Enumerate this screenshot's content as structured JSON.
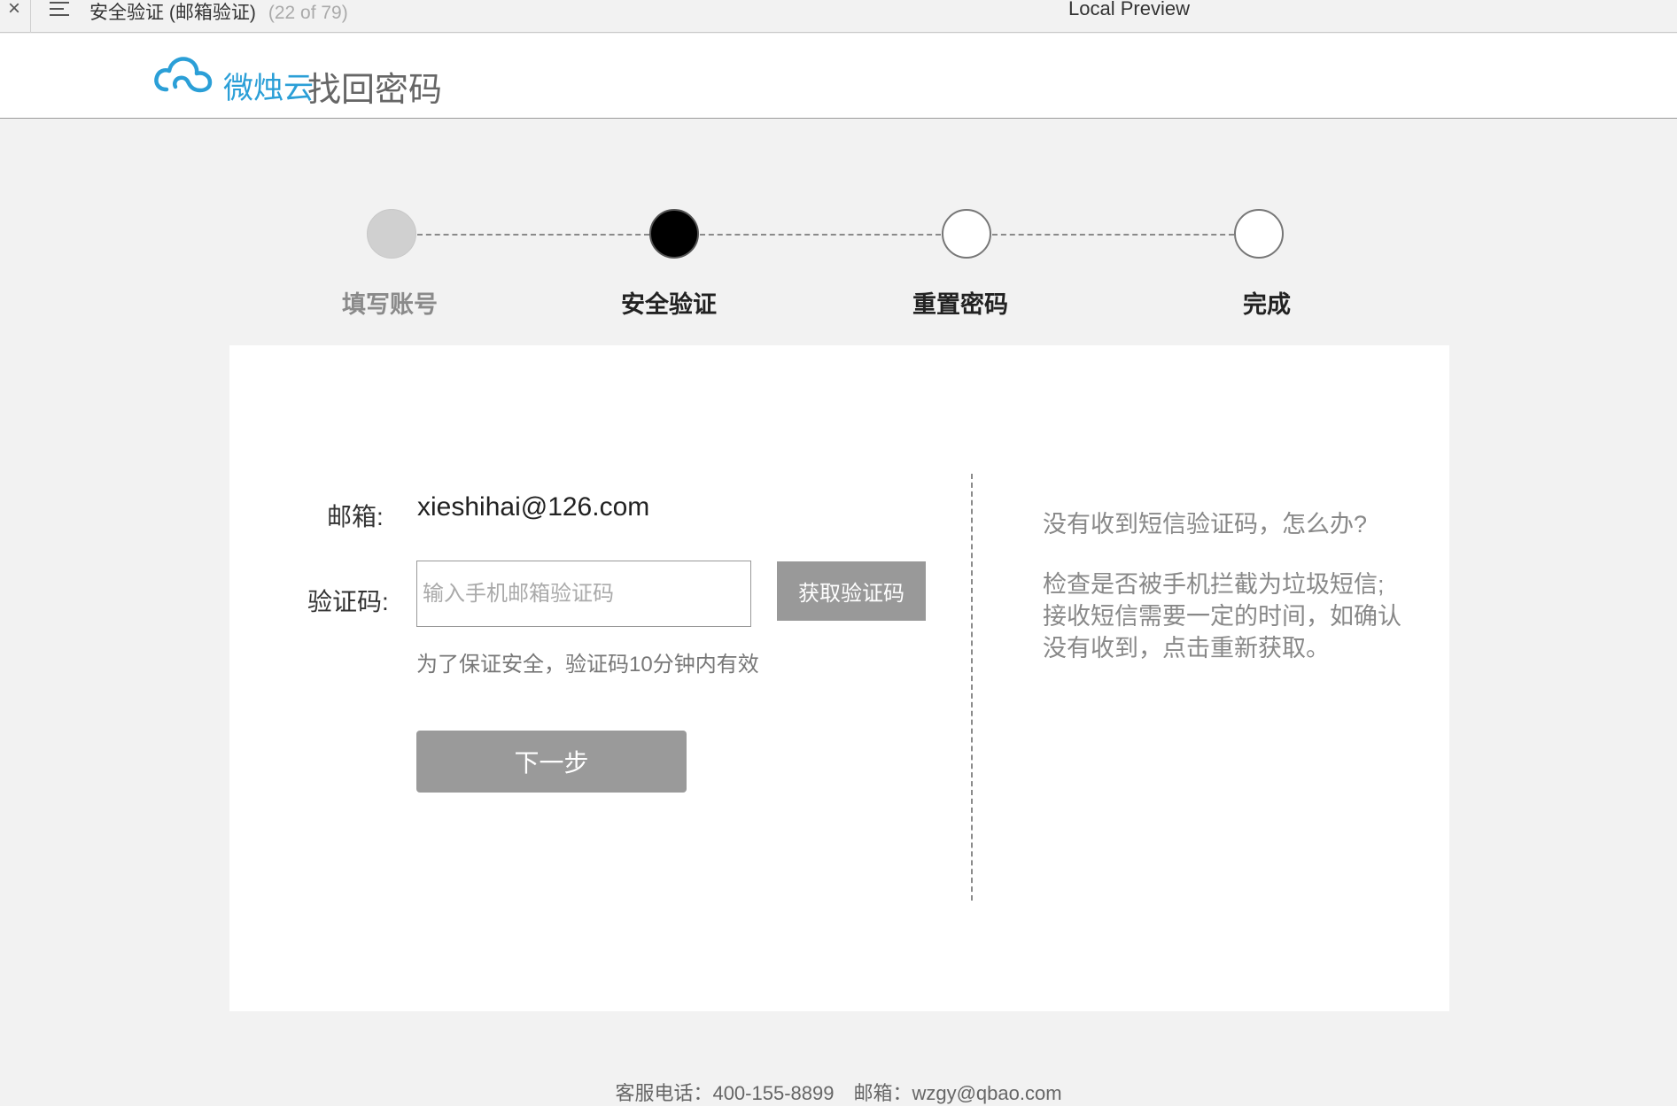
{
  "window": {
    "close_glyph": "×",
    "document_title": "安全验证 (邮箱验证)",
    "document_count": "(22 of 79)",
    "app_title": "Local Preview"
  },
  "header": {
    "brand": "微烛云",
    "heading": "找回密码",
    "logo_color": "#2b9fd7"
  },
  "steps": [
    {
      "label": "填写账号",
      "state": "done"
    },
    {
      "label": "安全验证",
      "state": "active"
    },
    {
      "label": "重置密码",
      "state": "todo"
    },
    {
      "label": "完成",
      "state": "todo"
    }
  ],
  "form": {
    "email_label": "邮箱:",
    "email_value": "xieshihai@126.com",
    "code_label": "验证码:",
    "code_placeholder": "输入手机邮箱验证码",
    "code_value": "",
    "get_code_label": "获取验证码",
    "hint": "为了保证安全，验证码10分钟内有效",
    "next_label": "下一步"
  },
  "help": {
    "question": "没有收到短信验证码，怎么办?",
    "lines": [
      "检查是否被手机拦截为垃圾短信;",
      "接收短信需要一定的时间，如确认",
      "没有收到，点击重新获取。"
    ]
  },
  "footer": {
    "phone": "客服电话：400-155-8899",
    "email": "邮箱：wzgy@qbao.com"
  }
}
